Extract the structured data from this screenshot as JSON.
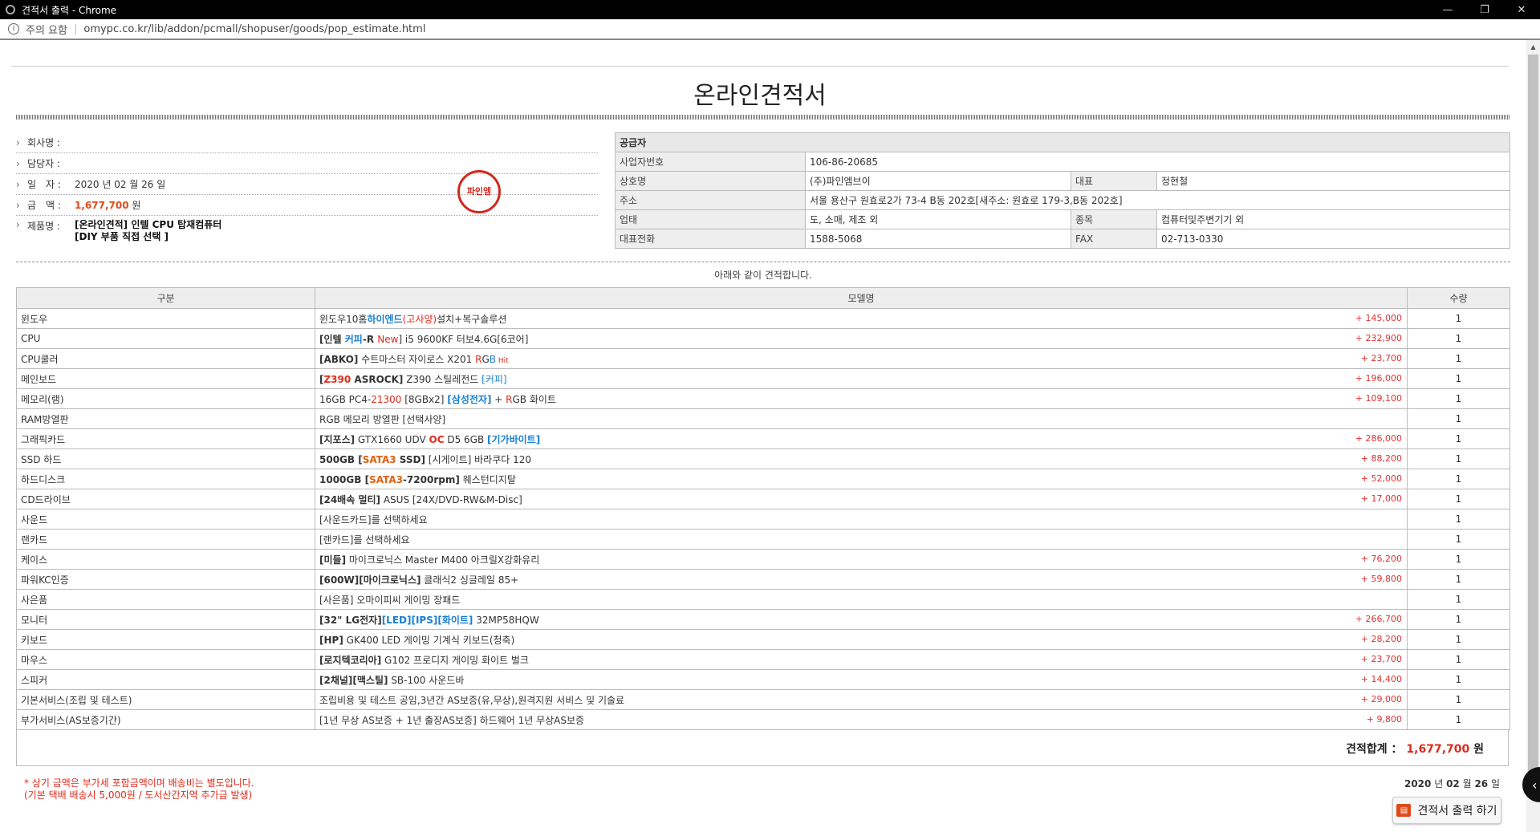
{
  "window": {
    "title": "견적서 출력 - Chrome",
    "btn_min": "—",
    "btn_restore": "❐",
    "btn_close": "✕"
  },
  "address": {
    "info_icon": "i",
    "warning": "주의 요함",
    "sep": "|",
    "url": "omypc.co.kr/lib/addon/pcmall/shopuser/goods/pop_estimate.html"
  },
  "doc_title": "온라인견적서",
  "client": {
    "company_label": "회사명 :",
    "company_value": "",
    "manager_label": "담당자 :",
    "manager_value": "",
    "date_label": "일　자 :",
    "date_value": "2020 년 02 월 26 일",
    "amount_label": "금　액 :",
    "amount_value": "1,677,700",
    "amount_unit": "원",
    "product_label": "제품명 :",
    "product_line1": "[온라인견적] 인텔 CPU 탑재컴퓨터",
    "product_line2": "[DIY 부품 직접 선택 ]"
  },
  "seal_text": "파인엠",
  "supplier": {
    "header": "공급자",
    "bizno_label": "사업자번호",
    "bizno": "106-86-20685",
    "name_label": "상호명",
    "name": "(주)파인엠브이",
    "ceo_label": "대표",
    "ceo": "정현철",
    "addr_label": "주소",
    "addr": "서울 용산구 원효로2가 73-4 B동 202호[새주소: 원효로 179-3,B동 202호]",
    "type_label": "업태",
    "type": "도, 소매, 제조 외",
    "kind_label": "종목",
    "kind": "컴퓨터및주변기기 외",
    "tel_label": "대표전화",
    "tel": "1588-5068",
    "fax_label": "FAX",
    "fax": "02-713-0330"
  },
  "as_follows": "아래와 같이 견적합니다.",
  "table_headers": {
    "category": "구분",
    "model": "모델명",
    "qty": "수량"
  },
  "items": [
    {
      "cat": "윈도우",
      "price": "+ 145,000",
      "qty": "1"
    },
    {
      "cat": "CPU",
      "price": "+ 232,900",
      "qty": "1"
    },
    {
      "cat": "CPU쿨러",
      "price": "+ 23,700",
      "qty": "1"
    },
    {
      "cat": "메인보드",
      "price": "+ 196,000",
      "qty": "1"
    },
    {
      "cat": "메모리(램)",
      "price": "+ 109,100",
      "qty": "1"
    },
    {
      "cat": "RAM방열판",
      "price": "",
      "qty": "1"
    },
    {
      "cat": "그래픽카드",
      "price": "+ 286,000",
      "qty": "1"
    },
    {
      "cat": "SSD 하드",
      "price": "+ 88,200",
      "qty": "1"
    },
    {
      "cat": "하드디스크",
      "price": "+ 52,000",
      "qty": "1"
    },
    {
      "cat": "CD드라이브",
      "price": "+ 17,000",
      "qty": "1"
    },
    {
      "cat": "사운드",
      "price": "",
      "qty": "1"
    },
    {
      "cat": "랜카드",
      "price": "",
      "qty": "1"
    },
    {
      "cat": "케이스",
      "price": "+ 76,200",
      "qty": "1"
    },
    {
      "cat": "파워KC인증",
      "price": "+ 59,800",
      "qty": "1"
    },
    {
      "cat": "사은품",
      "price": "",
      "qty": "1"
    },
    {
      "cat": "모니터",
      "price": "+ 266,700",
      "qty": "1"
    },
    {
      "cat": "키보드",
      "price": "+ 28,200",
      "qty": "1"
    },
    {
      "cat": "마우스",
      "price": "+ 23,700",
      "qty": "1"
    },
    {
      "cat": "스피커",
      "price": "+ 14,400",
      "qty": "1"
    },
    {
      "cat": "기본서비스(조립 및 테스트)",
      "price": "+ 29,000",
      "qty": "1"
    },
    {
      "cat": "부가서비스(AS보증기간)",
      "price": "+ 9,800",
      "qty": "1"
    }
  ],
  "models": {
    "m0": {
      "a": "윈도우10홈",
      "b": "하이엔드",
      "c": "(고사양)",
      "d": "설치+복구솔루션"
    },
    "m1": {
      "a": "[인텔 ",
      "b": "커피",
      "c": "-R ",
      "d": "New",
      "e": "] i5 9600KF 터보4.6G[6코어]"
    },
    "m2": {
      "a": "[ABKO]",
      "b": " 수트마스터 자이로스 X201 ",
      "c": "R",
      "d": "G",
      "e": "B",
      "f": " Hit"
    },
    "m3": {
      "a": "[",
      "b": "Z390",
      "c": " ASROCK]",
      "d": " Z390 스틸레전드 ",
      "e": "[커피]"
    },
    "m4": {
      "a": "16GB PC4-",
      "b": "21300",
      "c": " [8GBx2] ",
      "d": "[삼성전자]",
      "e": " + ",
      "f": "R",
      "g": "GB 화이트"
    },
    "m5": {
      "a": "RGB 메모리 방열판 [선택사양]"
    },
    "m6": {
      "a": "[지포스]",
      "b": " GTX1660 UDV ",
      "c": "OC",
      "d": " D5 6GB ",
      "e": "[기가바이트]"
    },
    "m7": {
      "a": "500GB [",
      "b": "SATA3",
      "c": " SSD]",
      "d": " [시게이트] 바라쿠다 120"
    },
    "m8": {
      "a": "1000GB [",
      "b": "SATA3",
      "c": "-7200rpm]",
      "d": " 웨스턴디지탈"
    },
    "m9": {
      "a": "[24배속 멀티]",
      "b": " ASUS [24X/DVD-RW&M-Disc]"
    },
    "m10": {
      "a": "[사운드카드]를 선택하세요"
    },
    "m11": {
      "a": "[랜카드]를 선택하세요"
    },
    "m12": {
      "a": "[미들]",
      "b": " 마이크로닉스 Master M400 아크릴X강화유리"
    },
    "m13": {
      "a": "[600W][마이크로닉스]",
      "b": " 클래식2 싱글레일 85+"
    },
    "m14": {
      "a": "[사은품] 오마이피씨 게이밍 장패드"
    },
    "m15": {
      "a": "[32\" LG전자]",
      "b": "[LED][IPS][화이트]",
      "c": " 32MP58HQW"
    },
    "m16": {
      "a": "[HP]",
      "b": " GK400 LED 게이밍 기계식 키보드(청축)"
    },
    "m17": {
      "a": "[로지텍코리아]",
      "b": " G102 프로디지 게이밍 화이트 벌크"
    },
    "m18": {
      "a": "[2채널][맥스틸]",
      "b": " SB-100 사운드바"
    },
    "m19": {
      "a": "조립비용 및 테스트 공임,3년간 AS보증(유,무상),원격지원 서비스 및 기술료"
    },
    "m20": {
      "a": "[1년 무상 AS보증 + 1년 출장AS보증] 하드웨어 1년 무상AS보증"
    }
  },
  "total": {
    "label": "견적합계 ：",
    "amount": "1,677,700",
    "unit": "원"
  },
  "notes": {
    "line1": "* 상기 금액은 부가세 포함금액이며 배송비는 별도입니다.",
    "line2": "(기본 택배 배송시 5,000원 / 도서산간지역 추가금 발생)"
  },
  "footer_date": {
    "y": "2020",
    "y_u": " 년 ",
    "m": "02",
    "m_u": " 월 ",
    "d": "26",
    "d_u": " 일"
  },
  "print_button": {
    "icon": "▤",
    "label": "견적서 출력 하기"
  },
  "side_widget": "‹",
  "icons": {
    "chevron": "›",
    "scroll_up": "▲"
  }
}
